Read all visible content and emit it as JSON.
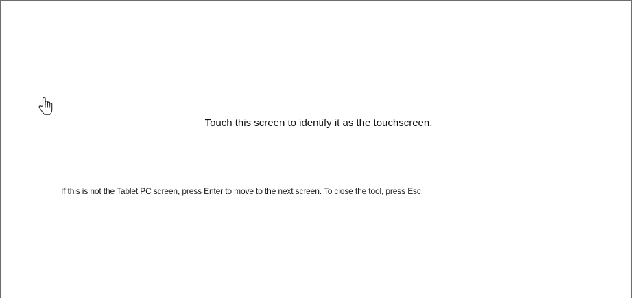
{
  "touchscreen_prompt": {
    "cursor_icon": "hand-pointer-icon",
    "instruction": "Touch this screen to identify it as the touchscreen.",
    "secondary_instruction": "If this is not the Tablet PC screen, press Enter to move to the next screen. To close the tool, press Esc."
  }
}
